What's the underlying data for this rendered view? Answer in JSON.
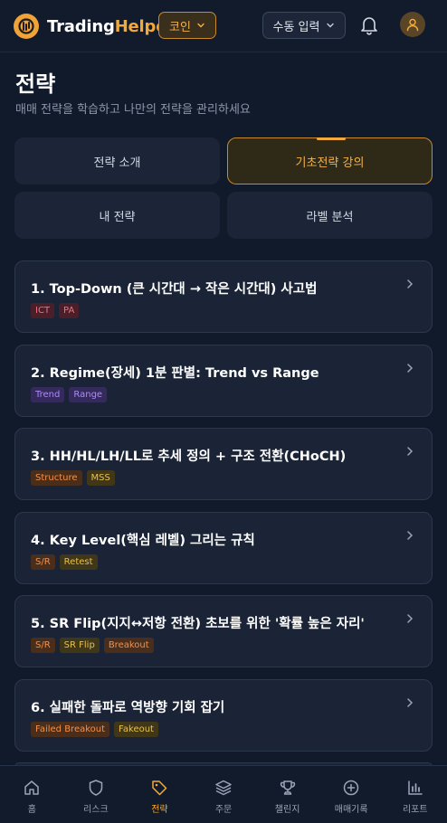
{
  "header": {
    "brand_prefix": "Trading",
    "brand_suffix": "Helper",
    "coin_label": "코인",
    "manual_label": "수동 입력"
  },
  "page": {
    "title": "전략",
    "subtitle": "매매 전략을 학습하고 나만의 전략을 관리하세요"
  },
  "tabs": [
    {
      "label": "전략 소개",
      "active": false
    },
    {
      "label": "기초전략 강의",
      "active": true
    },
    {
      "label": "내 전략",
      "active": false
    },
    {
      "label": "라벨 분석",
      "active": false
    }
  ],
  "lessons": [
    {
      "title": "1. Top-Down (큰 시간대 → 작은 시간대) 사고법",
      "tags": [
        {
          "text": "ICT",
          "color": "red"
        },
        {
          "text": "PA",
          "color": "red"
        }
      ]
    },
    {
      "title": "2. Regime(장세) 1분 판별: Trend vs Range",
      "tags": [
        {
          "text": "Trend",
          "color": "purple"
        },
        {
          "text": "Range",
          "color": "purple"
        }
      ]
    },
    {
      "title": "3. HH/HL/LH/LL로 추세 정의 + 구조 전환(CHoCH)",
      "tags": [
        {
          "text": "Structure",
          "color": "orange"
        },
        {
          "text": "MSS",
          "color": "yellow"
        }
      ]
    },
    {
      "title": "4. Key Level(핵심 레벨) 그리는 규칙",
      "tags": [
        {
          "text": "S/R",
          "color": "orange"
        },
        {
          "text": "Retest",
          "color": "yellow"
        }
      ]
    },
    {
      "title": "5. SR Flip(지지↔저항 전환) 초보를 위한 '확률 높은 자리'",
      "tags": [
        {
          "text": "S/R",
          "color": "orange"
        },
        {
          "text": "SR Flip",
          "color": "yellow"
        },
        {
          "text": "Breakout",
          "color": "orange"
        }
      ]
    },
    {
      "title": "6. 실패한 돌파로 역방향 기회 잡기",
      "tags": [
        {
          "text": "Failed Breakout",
          "color": "orange"
        },
        {
          "text": "Fakeout",
          "color": "yellow"
        }
      ]
    }
  ],
  "bottom_nav": [
    {
      "label": "홈",
      "icon": "home-icon",
      "active": false
    },
    {
      "label": "리스크",
      "icon": "shield-icon",
      "active": false
    },
    {
      "label": "전략",
      "icon": "tag-icon",
      "active": true
    },
    {
      "label": "주문",
      "icon": "layers-icon",
      "active": false
    },
    {
      "label": "챌린지",
      "icon": "trophy-icon",
      "active": false
    },
    {
      "label": "매매기록",
      "icon": "plus-circle-icon",
      "active": false
    },
    {
      "label": "리포트",
      "icon": "bar-chart-icon",
      "active": false
    }
  ]
}
